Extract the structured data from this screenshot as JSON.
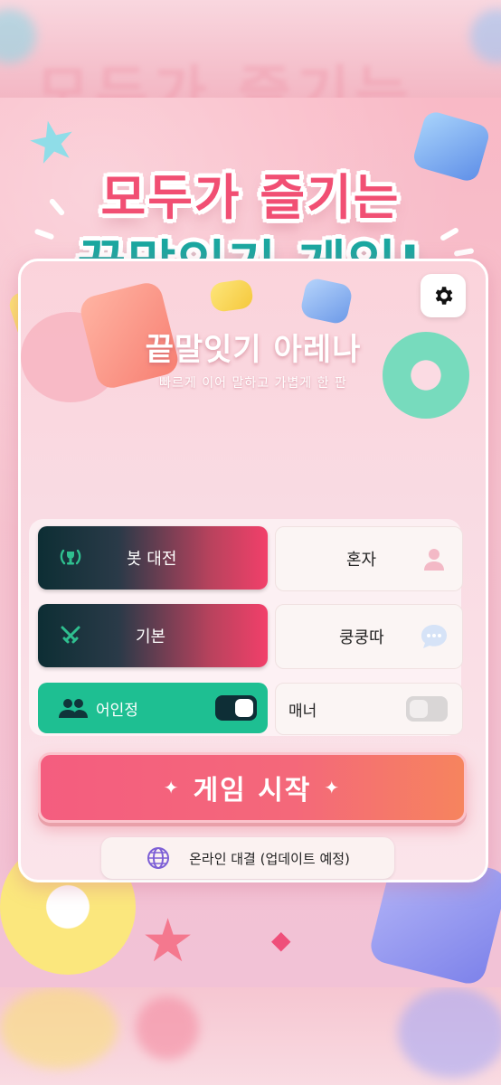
{
  "hero": {
    "line1": "모두가 즐기는",
    "line2": "끝말잇기 게임!"
  },
  "card": {
    "title": "끝말잇기 아레나",
    "subtitle": "빠르게 이어 말하고 가볍게 한 판",
    "settings_icon": "gear-icon"
  },
  "options": {
    "row1": {
      "left_label": "봇 대전",
      "left_icon": "trophy-wreath-icon",
      "right_label": "혼자",
      "right_icon": "person-icon"
    },
    "row2": {
      "left_label": "기본",
      "left_icon": "crossed-swords-icon",
      "right_label": "쿵쿵따",
      "right_icon": "chat-bubble-icon"
    },
    "row3": {
      "left_label": "어인정",
      "left_icon": "users-icon",
      "left_toggle": true,
      "right_label": "매너",
      "right_toggle": false
    }
  },
  "actions": {
    "start_label": "게임 시작",
    "start_sparkle": "✦",
    "online_label": "온라인 대결 (업데이트 예정)",
    "online_icon": "globe-icon"
  },
  "colors": {
    "accent_pink": "#f45d7f",
    "accent_teal": "#1dbf95",
    "dark_navy": "#0d2e34"
  }
}
